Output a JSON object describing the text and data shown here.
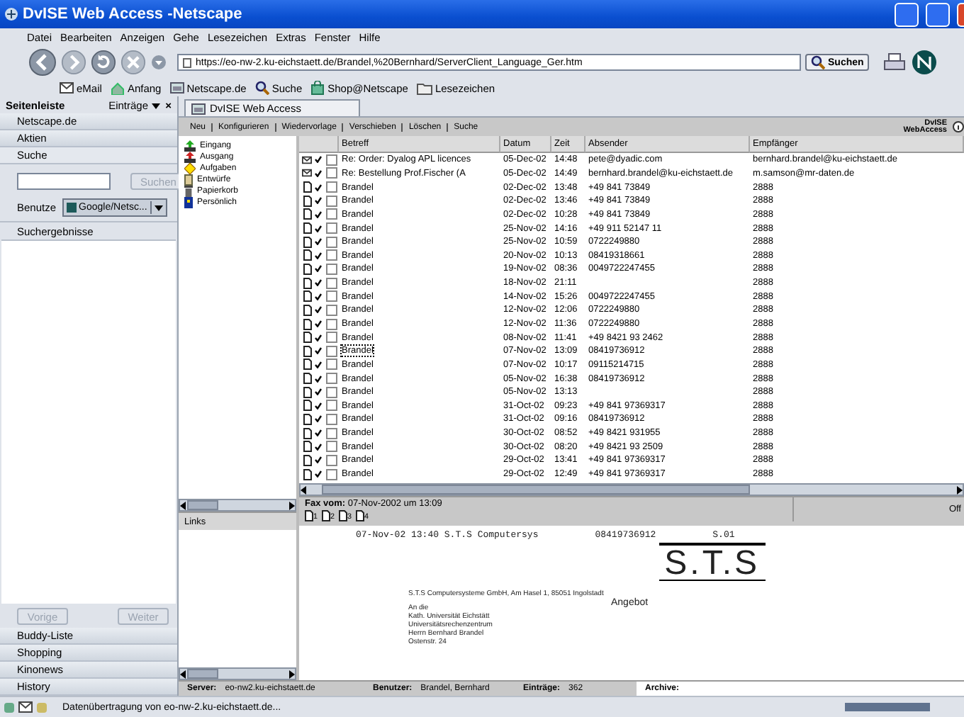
{
  "window": {
    "title": "DvISE Web Access -Netscape"
  },
  "menu": [
    "Datei",
    "Bearbeiten",
    "Anzeigen",
    "Gehe",
    "Lesezeichen",
    "Extras",
    "Fenster",
    "Hilfe"
  ],
  "navigation": {
    "url": "https://eo-nw-2.ku-eichstaett.de/Brandel,%20Bernhard/ServerClient_Language_Ger.htm",
    "search_button": "Suchen"
  },
  "personal_toolbar": [
    {
      "label": "eMail",
      "kind": "mail"
    },
    {
      "label": "Anfang",
      "kind": "home"
    },
    {
      "label": "Netscape.de",
      "kind": "site"
    },
    {
      "label": "Suche",
      "kind": "search"
    },
    {
      "label": "Shop@Netscape",
      "kind": "shop"
    },
    {
      "label": "Lesezeichen",
      "kind": "folder"
    }
  ],
  "sidebar": {
    "title": "Seitenleiste",
    "entries_menu": "Einträge",
    "close": "×",
    "panels_top": [
      {
        "label": "Netscape.de",
        "selected": false
      },
      {
        "label": "Aktien",
        "selected": false
      },
      {
        "label": "Suche",
        "selected": true
      }
    ],
    "search_button": "Suchen",
    "use_label": "Benutze",
    "engine": "Google/Netsc...",
    "results_label": "Suchergebnisse",
    "prev_button": "Vorige",
    "next_button": "Weiter",
    "panels_bottom": [
      "Buddy-Liste",
      "Shopping",
      "Kinonews",
      "History"
    ]
  },
  "tab": {
    "label": "DvISE Web Access"
  },
  "app_toolbar": [
    "Neu",
    "Konfigurieren",
    "Wiedervorlage",
    "Verschieben",
    "Löschen",
    "Suche"
  ],
  "brand": {
    "line1": "DvISE",
    "line2": "WebAccess"
  },
  "folders": [
    {
      "label": "Eingang",
      "kind": "inbox"
    },
    {
      "label": "Ausgang",
      "kind": "outbox"
    },
    {
      "label": "Aufgaben",
      "kind": "tasks"
    },
    {
      "label": "Entwürfe",
      "kind": "drafts"
    },
    {
      "label": "Papierkorb",
      "kind": "trash"
    },
    {
      "label": "Persönlich",
      "kind": "personal"
    }
  ],
  "table": {
    "columns": [
      "Betreff",
      "Datum",
      "Zeit",
      "Absender",
      "Empfänger"
    ],
    "rows": [
      {
        "kind": "mail",
        "read": true,
        "checked": false,
        "selected": false,
        "subject": "Re: Order: Dyalog APL licences",
        "date": "05-Dec-02",
        "time": "14:48",
        "sender": "pete@dyadic.com",
        "recipient": "bernhard.brandel@ku-eichstaett.de"
      },
      {
        "kind": "mail",
        "read": true,
        "checked": false,
        "selected": false,
        "subject": "Re: Bestellung Prof.Fischer (A",
        "date": "05-Dec-02",
        "time": "14:49",
        "sender": "bernhard.brandel@ku-eichstaett.de",
        "recipient": "m.samson@mr-daten.de"
      },
      {
        "kind": "fax",
        "read": true,
        "checked": false,
        "selected": false,
        "subject": "Brandel",
        "date": "02-Dec-02",
        "time": "13:48",
        "sender": "+49 841 73849",
        "recipient": "2888"
      },
      {
        "kind": "fax",
        "read": true,
        "checked": false,
        "selected": false,
        "subject": "Brandel",
        "date": "02-Dec-02",
        "time": "13:46",
        "sender": "+49 841 73849",
        "recipient": "2888"
      },
      {
        "kind": "fax",
        "read": true,
        "checked": false,
        "selected": false,
        "subject": "Brandel",
        "date": "02-Dec-02",
        "time": "10:28",
        "sender": "+49 841 73849",
        "recipient": "2888"
      },
      {
        "kind": "fax",
        "read": true,
        "checked": false,
        "selected": false,
        "subject": "Brandel",
        "date": "25-Nov-02",
        "time": "14:16",
        "sender": "+49 911 52147 11",
        "recipient": "2888"
      },
      {
        "kind": "fax",
        "read": true,
        "checked": false,
        "selected": false,
        "subject": "Brandel",
        "date": "25-Nov-02",
        "time": "10:59",
        "sender": "0722249880",
        "recipient": "2888"
      },
      {
        "kind": "fax",
        "read": true,
        "checked": false,
        "selected": false,
        "subject": "Brandel",
        "date": "20-Nov-02",
        "time": "10:13",
        "sender": "08419318661",
        "recipient": "2888"
      },
      {
        "kind": "fax",
        "read": true,
        "checked": false,
        "selected": false,
        "subject": "Brandel",
        "date": "19-Nov-02",
        "time": "08:36",
        "sender": "0049722247455",
        "recipient": "2888"
      },
      {
        "kind": "fax",
        "read": true,
        "checked": false,
        "selected": false,
        "subject": "Brandel",
        "date": "18-Nov-02",
        "time": "21:11",
        "recipient": "2888"
      },
      {
        "kind": "fax",
        "read": true,
        "checked": false,
        "selected": false,
        "subject": "Brandel",
        "date": "14-Nov-02",
        "time": "15:26",
        "sender": "0049722247455",
        "recipient": "2888"
      },
      {
        "kind": "fax",
        "read": true,
        "checked": false,
        "selected": false,
        "subject": "Brandel",
        "date": "12-Nov-02",
        "time": "12:06",
        "sender": "0722249880",
        "recipient": "2888"
      },
      {
        "kind": "fax",
        "read": true,
        "checked": false,
        "selected": false,
        "subject": "Brandel",
        "date": "12-Nov-02",
        "time": "11:36",
        "sender": "0722249880",
        "recipient": "2888"
      },
      {
        "kind": "fax",
        "read": true,
        "checked": false,
        "selected": false,
        "subject": "Brandel",
        "date": "08-Nov-02",
        "time": "11:41",
        "sender": "+49 8421 93 2462",
        "recipient": "2888"
      },
      {
        "kind": "fax",
        "read": true,
        "checked": false,
        "selected": true,
        "subject": "Brandel",
        "date": "07-Nov-02",
        "time": "13:09",
        "sender": "08419736912",
        "recipient": "2888"
      },
      {
        "kind": "fax",
        "read": true,
        "checked": false,
        "selected": false,
        "subject": "Brandel",
        "date": "07-Nov-02",
        "time": "10:17",
        "sender": "09115214715",
        "recipient": "2888"
      },
      {
        "kind": "fax",
        "read": true,
        "checked": false,
        "selected": false,
        "subject": "Brandel",
        "date": "05-Nov-02",
        "time": "16:38",
        "sender": "08419736912",
        "recipient": "2888"
      },
      {
        "kind": "fax",
        "read": true,
        "checked": false,
        "selected": false,
        "subject": "Brandel",
        "date": "05-Nov-02",
        "time": "13:13",
        "recipient": "2888"
      },
      {
        "kind": "fax",
        "read": true,
        "checked": false,
        "selected": false,
        "subject": "Brandel",
        "date": "31-Oct-02",
        "time": "09:23",
        "sender": "+49 841 97369317",
        "recipient": "2888"
      },
      {
        "kind": "fax",
        "read": true,
        "checked": false,
        "selected": false,
        "subject": "Brandel",
        "date": "31-Oct-02",
        "time": "09:16",
        "sender": "08419736912",
        "recipient": "2888"
      },
      {
        "kind": "fax",
        "read": true,
        "checked": false,
        "selected": false,
        "subject": "Brandel",
        "date": "30-Oct-02",
        "time": "08:52",
        "sender": "+49 8421 931955",
        "recipient": "2888"
      },
      {
        "kind": "fax",
        "read": true,
        "checked": false,
        "selected": false,
        "subject": "Brandel",
        "date": "30-Oct-02",
        "time": "08:20",
        "sender": "+49 8421 93 2509",
        "recipient": "2888"
      },
      {
        "kind": "fax",
        "read": true,
        "checked": false,
        "selected": false,
        "subject": "Brandel",
        "date": "29-Oct-02",
        "time": "13:41",
        "sender": "+49 841 97369317",
        "recipient": "2888"
      },
      {
        "kind": "fax",
        "read": true,
        "checked": false,
        "selected": false,
        "subject": "Brandel",
        "date": "29-Oct-02",
        "time": "12:49",
        "sender": "+49 841 97369317",
        "recipient": "2888"
      }
    ]
  },
  "links_pane": {
    "title": "Links"
  },
  "fax": {
    "label": "Fax vom:",
    "value": "07-Nov-2002 um 13:09",
    "pages": [
      "1",
      "2",
      "3",
      "4"
    ],
    "right_label": "Off"
  },
  "document": {
    "header": [
      "07-Nov-02 13:40  S.T.S Computersys",
      "08419736912",
      "S.01"
    ],
    "logo": "S.T.S",
    "sender_line": "S.T.S Computersysteme GmbH, Am Hasel 1, 85051 Ingolstadt",
    "address": [
      "An die",
      "Kath. Universität Eichstätt",
      "Universitätsrechenzentrum",
      "Herrn Bernhard Brandel",
      "Ostenstr. 24"
    ],
    "subject": "Angebot"
  },
  "app_status": [
    {
      "label": "Server:",
      "value": "eo-nw2.ku-eichstaett.de"
    },
    {
      "label": "Benutzer:",
      "value": "Brandel, Bernhard"
    },
    {
      "label": "Einträge:",
      "value": "362"
    },
    {
      "label": "Archive:"
    }
  ],
  "status_bar": {
    "text": "Datenübertragung von eo-nw-2.ku-eichstaett.de..."
  }
}
